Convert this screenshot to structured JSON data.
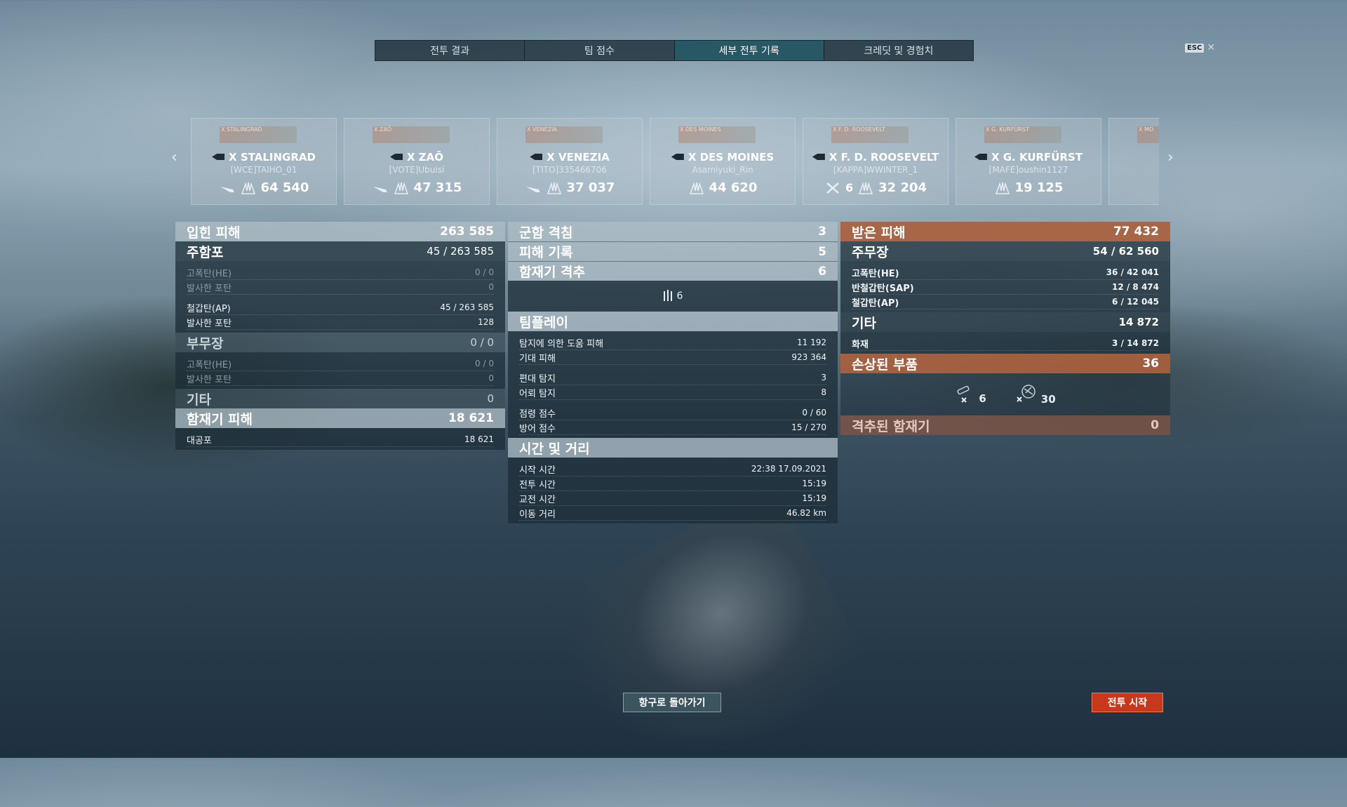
{
  "tabs": [
    "전투 결과",
    "팀 점수",
    "세부 전투 기록",
    "크레딧 및 경험치"
  ],
  "active_tab": 2,
  "esc_label": "ESC",
  "ships": [
    {
      "mini": "X STALINGRAD",
      "name": "X STALINGRAD",
      "player": "[WCE]TAIHO_01",
      "damage": "64 540",
      "count": ""
    },
    {
      "mini": "X ZAŌ",
      "name": "X ZAŌ",
      "player": "[VOTE]Ubuisi",
      "damage": "47 315",
      "count": ""
    },
    {
      "mini": "X VENEZIA",
      "name": "X VENEZIA",
      "player": "[TITO]335466706",
      "damage": "37 037",
      "count": ""
    },
    {
      "mini": "X DES MOINES",
      "name": "X DES MOINES",
      "player": "Asamiyuki_Rin",
      "damage": "44 620",
      "count": ""
    },
    {
      "mini": "X F. D. ROOSEVELT",
      "name": "X F. D. ROOSEVELT",
      "player": "[KAPPA]WWINTER_1",
      "damage": "32 204",
      "count": "6"
    },
    {
      "mini": "X G. KURFÜRST",
      "name": "X G. KURFÜRST",
      "player": "[MAFE]oushin1127",
      "damage": "19 125",
      "count": ""
    },
    {
      "mini": "X MO",
      "name": "",
      "player": "[G",
      "damage": "",
      "count": ""
    }
  ],
  "left": {
    "dealt": {
      "label": "입힌 피해",
      "value": "263 585"
    },
    "main": {
      "label": "주함포",
      "value": "45 / 263 585"
    },
    "main_rows": [
      {
        "label": "고폭탄(HE)",
        "value": "0 / 0",
        "dim": true
      },
      {
        "label": "발사한 포탄",
        "value": "0",
        "dim": true
      },
      {
        "label": "철갑탄(AP)",
        "value": "45 / 263 585",
        "dim": false
      },
      {
        "label": "발사한 포탄",
        "value": "128",
        "dim": false
      }
    ],
    "secondary": {
      "label": "부무장",
      "value": "0 / 0"
    },
    "secondary_rows": [
      {
        "label": "고폭탄(HE)",
        "value": "0 / 0"
      },
      {
        "label": "발사한 포탄",
        "value": "0"
      }
    ],
    "other": {
      "label": "기타",
      "value": "0"
    },
    "aircraft": {
      "label": "함재기 피해",
      "value": "18 621"
    },
    "aircraft_rows": [
      {
        "label": "대공포",
        "value": "18 621"
      }
    ]
  },
  "middle": {
    "kills": {
      "label": "군함 격침",
      "value": "3"
    },
    "damage_records": {
      "label": "피해 기록",
      "value": "5"
    },
    "planes": {
      "label": "함재기 격추",
      "value": "6"
    },
    "planes_count": "6",
    "teamplay": {
      "label": "팀플레이"
    },
    "teamplay_rows": [
      {
        "label": "탐지에 의한 도움 피해",
        "value": "11 192"
      },
      {
        "label": "기대 피해",
        "value": "923 364"
      },
      {
        "gap": true
      },
      {
        "label": "편대 탐지",
        "value": "3"
      },
      {
        "label": "어뢰 탐지",
        "value": "8"
      },
      {
        "gap": true
      },
      {
        "label": "점령 점수",
        "value": "0 / 60"
      },
      {
        "label": "방어 점수",
        "value": "15 / 270"
      }
    ],
    "time": {
      "label": "시간 및 거리"
    },
    "time_rows": [
      {
        "label": "시작 시간",
        "value": "22:38  17.09.2021"
      },
      {
        "label": "전투 시간",
        "value": "15:19"
      },
      {
        "label": "교전 시간",
        "value": "15:19"
      },
      {
        "label": "이동 거리",
        "value": "46.82 km"
      }
    ]
  },
  "right": {
    "received": {
      "label": "받은 피해",
      "value": "77 432"
    },
    "main": {
      "label": "주무장",
      "value": "54 / 62 560"
    },
    "main_rows": [
      {
        "label": "고폭탄(HE)",
        "value": "36 / 42 041"
      },
      {
        "label": "반철갑탄(SAP)",
        "value": "12 / 8 474"
      },
      {
        "label": "철갑탄(AP)",
        "value": "6 / 12 045"
      }
    ],
    "other": {
      "label": "기타",
      "value": "14 872"
    },
    "other_rows": [
      {
        "label": "화재",
        "value": "3 / 14 872"
      }
    ],
    "modules": {
      "label": "손상된 부품",
      "value": "36"
    },
    "module_counts": [
      "6",
      "30"
    ],
    "planes_shot": {
      "label": "격추된 함재기",
      "value": "0"
    }
  },
  "buttons": {
    "port": "항구로 돌아가기",
    "battle": "전투 시작"
  }
}
